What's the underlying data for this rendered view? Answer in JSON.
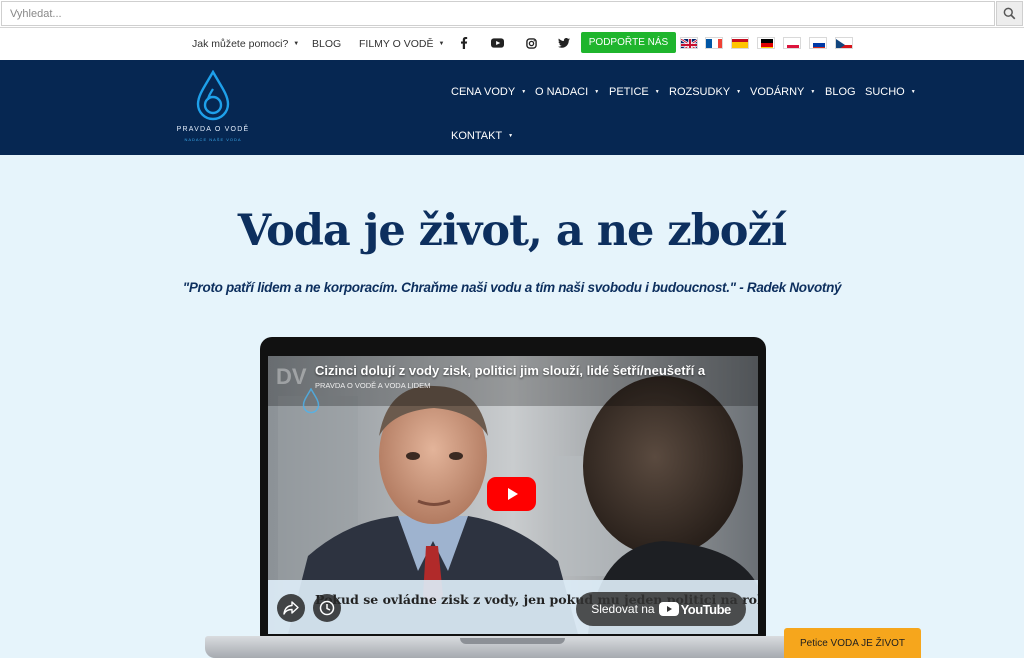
{
  "search": {
    "placeholder": "Vyhledat..."
  },
  "topbar": {
    "help_label": "Jak můžete pomoci?",
    "blog_label": "BLOG",
    "films_label": "FILMY O VODĚ",
    "support_label": "PODPOŘTE NÁS",
    "social_icons": [
      "facebook-icon",
      "youtube-icon",
      "instagram-icon",
      "twitter-icon"
    ],
    "flags": [
      "english",
      "french",
      "spanish",
      "german",
      "polish",
      "russian",
      "czech"
    ]
  },
  "logo": {
    "title": "PRAVDA O VODĚ",
    "subtitle": "NADACE NAŠE VODA"
  },
  "nav": {
    "items": [
      {
        "label": "CENA VODY",
        "dropdown": true
      },
      {
        "label": "O NADACI",
        "dropdown": true
      },
      {
        "label": "PETICE",
        "dropdown": true
      },
      {
        "label": "ROZSUDKY",
        "dropdown": true
      },
      {
        "label": "VODÁRNY",
        "dropdown": true
      },
      {
        "label": "BLOG",
        "dropdown": false
      },
      {
        "label": "SUCHO",
        "dropdown": true
      },
      {
        "label": "KONTAKT",
        "dropdown": true
      }
    ]
  },
  "hero": {
    "title": "Voda je život, a ne zboží",
    "quote": "\"Proto patří lidem a ne korporacím. Chraňme naši vodu a tím naši  svobodu i budoucnost.\" -  Radek Novotný"
  },
  "video": {
    "title": "Cizinci dolují z vody zisk, politici jim slouží, lidé šetří/neušetří a",
    "channel": "PRAVDA O VODĚ A VODA LIDEM",
    "corner_text": "DV",
    "subtitle": "Pokud se ovládne zisk z vody, jen pokud mu jeden politici na roku",
    "watch_label": "Sledovat na",
    "youtube_word": "YouTube"
  },
  "petice_label": "Petice VODA JE ŽIVOT",
  "colors": {
    "nav_bg": "#062752",
    "hero_bg": "#e6f4fb",
    "title_color": "#0d2f5e",
    "support_green": "#1fb52d",
    "petice_orange": "#f6a61c"
  }
}
